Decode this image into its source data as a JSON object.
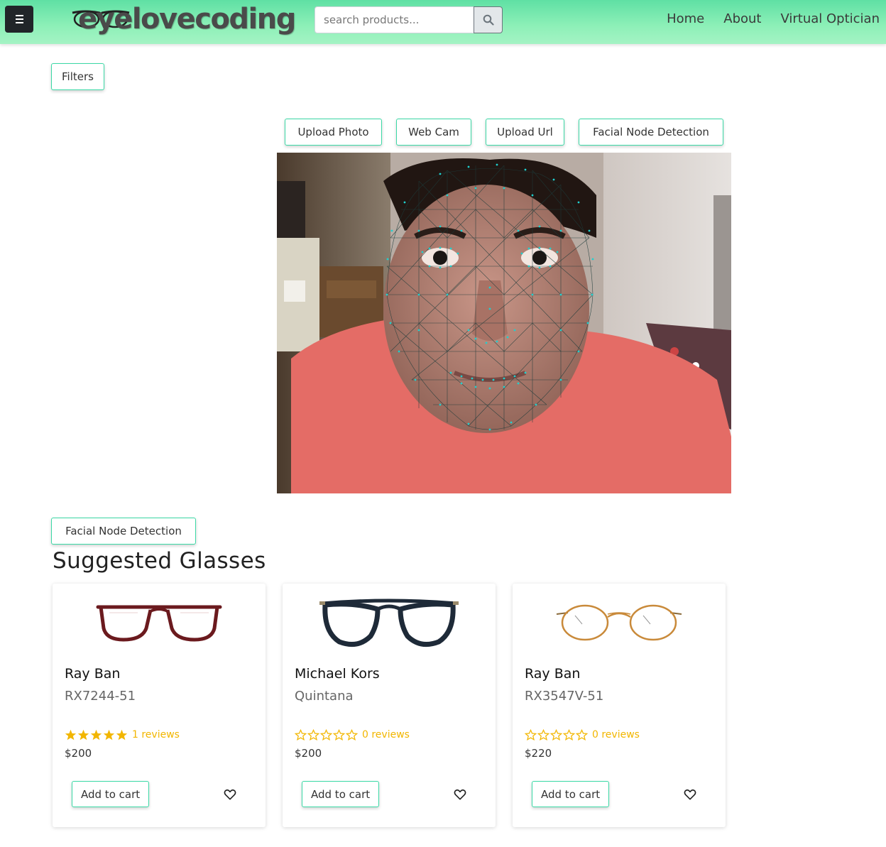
{
  "header": {
    "logo_text": "eyelovecoding",
    "search_placeholder": "search products...",
    "nav": [
      {
        "label": "Home"
      },
      {
        "label": "About"
      },
      {
        "label": "Virtual Optician"
      }
    ]
  },
  "filters_label": "Filters",
  "source_buttons": [
    {
      "label": "Upload Photo"
    },
    {
      "label": "Web Cam"
    },
    {
      "label": "Upload Url"
    },
    {
      "label": "Facial Node Detection"
    }
  ],
  "detect_button_label": "Facial Node Detection",
  "suggested_title": "Suggested Glasses",
  "products": [
    {
      "brand": "Ray Ban",
      "model": "RX7244-51",
      "rating": 5,
      "reviews": "1 reviews",
      "price": "$200",
      "cart_label": "Add to cart",
      "frame_color": "#6b1a1e"
    },
    {
      "brand": "Michael Kors",
      "model": "Quintana",
      "rating": 0,
      "reviews": "0 reviews",
      "price": "$200",
      "cart_label": "Add to cart",
      "frame_color": "#1e2a38"
    },
    {
      "brand": "Ray Ban",
      "model": "RX3547V-51",
      "rating": 0,
      "reviews": "0 reviews",
      "price": "$220",
      "cart_label": "Add to cart",
      "frame_color": "#c98a3a"
    }
  ],
  "colors": {
    "accent": "#3bd9a6",
    "star": "#f2b600",
    "mesh": "#20c9c9"
  }
}
